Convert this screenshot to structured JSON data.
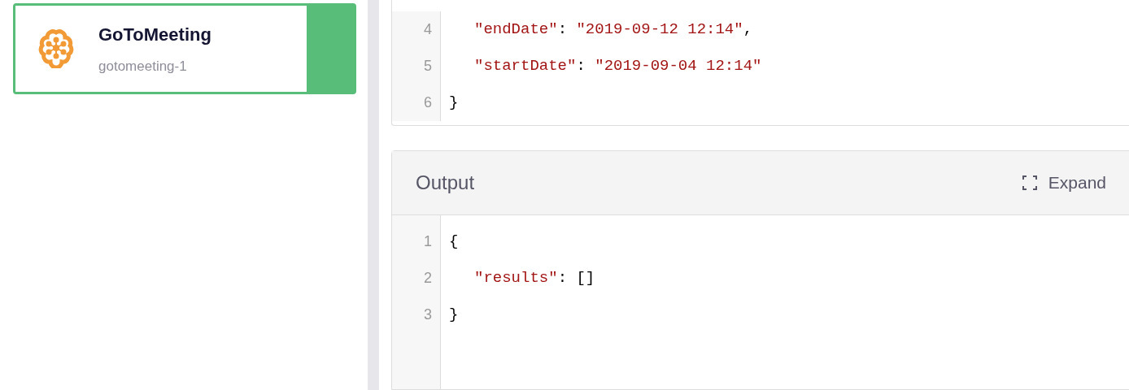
{
  "integration": {
    "title": "GoToMeeting",
    "subtitle": "gotomeeting-1",
    "selected": true
  },
  "input_code": {
    "lines": [
      {
        "number": "4",
        "indented": true,
        "tokens": [
          {
            "kind": "string",
            "text": "\"endDate\""
          },
          {
            "kind": "punct",
            "text": ": "
          },
          {
            "kind": "string",
            "text": "\"2019-09-12 12:14\""
          },
          {
            "kind": "punct",
            "text": ","
          }
        ]
      },
      {
        "number": "5",
        "indented": true,
        "tokens": [
          {
            "kind": "string",
            "text": "\"startDate\""
          },
          {
            "kind": "punct",
            "text": ": "
          },
          {
            "kind": "string",
            "text": "\"2019-09-04 12:14\""
          }
        ]
      },
      {
        "number": "6",
        "indented": false,
        "tokens": [
          {
            "kind": "punct",
            "text": "}"
          }
        ]
      }
    ]
  },
  "output": {
    "title": "Output",
    "expand_label": "Expand",
    "lines": [
      {
        "number": "1",
        "indented": false,
        "tokens": [
          {
            "kind": "punct",
            "text": "{"
          }
        ]
      },
      {
        "number": "2",
        "indented": true,
        "tokens": [
          {
            "kind": "string",
            "text": "\"results\""
          },
          {
            "kind": "punct",
            "text": ": "
          },
          {
            "kind": "punct",
            "text": "[]"
          }
        ]
      },
      {
        "number": "3",
        "indented": false,
        "tokens": [
          {
            "kind": "punct",
            "text": "}"
          }
        ]
      }
    ]
  }
}
